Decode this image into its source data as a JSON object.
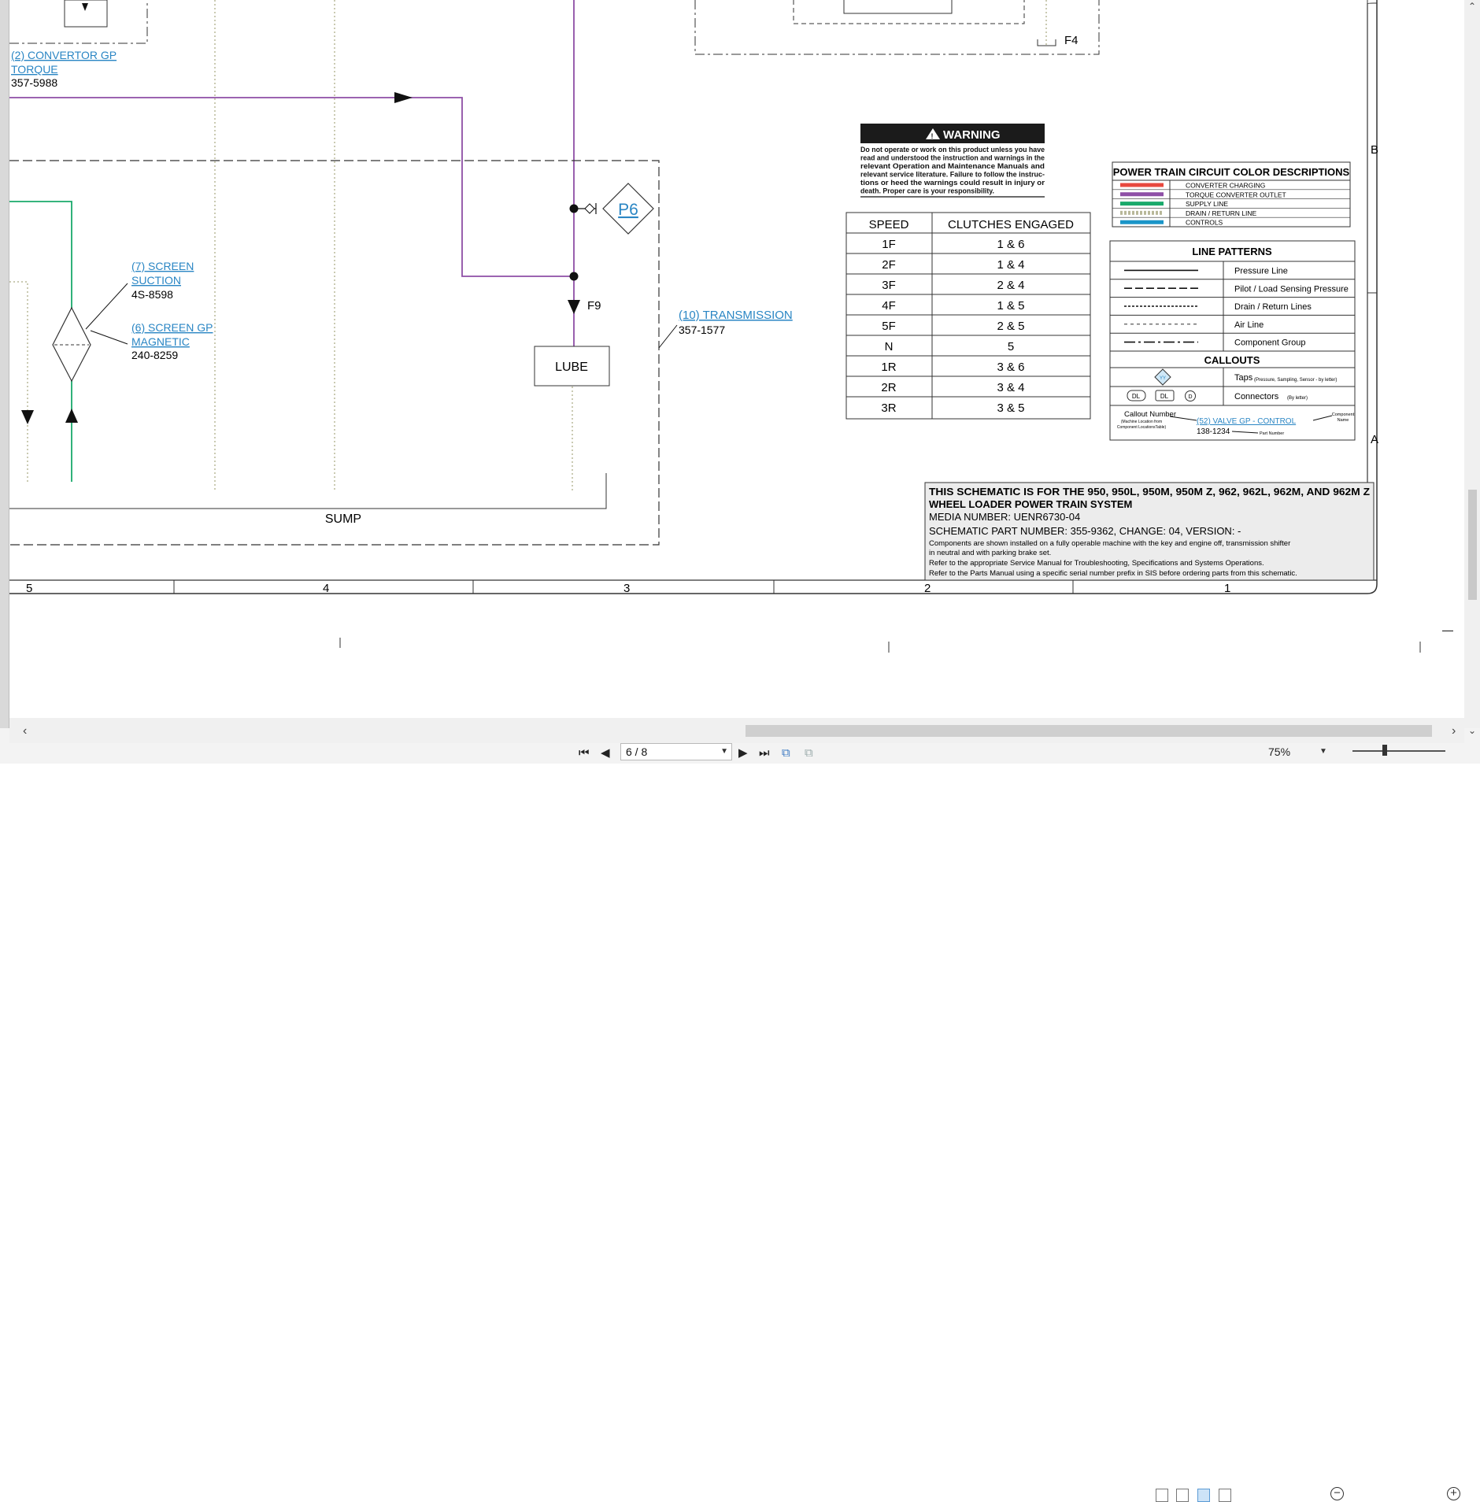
{
  "document": {
    "labels": {
      "convertor": {
        "link": [
          "(2) CONVERTOR GP",
          "TORQUE"
        ],
        "part": "357-5988"
      },
      "screen_suction": {
        "link": [
          "(7) SCREEN ",
          "SUCTION"
        ],
        "part": "4S-8598"
      },
      "screen_magnetic": {
        "link": [
          "(6) SCREEN GP",
          "MAGNETIC"
        ],
        "part": "240-8259"
      },
      "transmission": {
        "link": "(10) TRANSMISSION",
        "part": "357-1577"
      },
      "tap_p6": "P6",
      "f9": "F9",
      "f4": "F4",
      "lube": "LUBE",
      "sump": "SUMP"
    },
    "warning": {
      "title": "WARNING",
      "lines": [
        "Do not operate or work on this product unless you have",
        "read and understood the instruction and warnings in the",
        "relevant Operation and Maintenance Manuals and",
        "relevant service literature. Failure to follow the instruc-",
        "tions or heed the warnings could result in injury or",
        "death. Proper care is your responsibility."
      ]
    },
    "speed_table": {
      "headers": [
        "SPEED",
        "CLUTCHES ENGAGED"
      ],
      "rows": [
        [
          "1F",
          "1 & 6"
        ],
        [
          "2F",
          "1 & 4"
        ],
        [
          "3F",
          "2 & 4"
        ],
        [
          "4F",
          "1 & 5"
        ],
        [
          "5F",
          "2 & 5"
        ],
        [
          "N",
          "5"
        ],
        [
          "1R",
          "3 & 6"
        ],
        [
          "2R",
          "3 & 4"
        ],
        [
          "3R",
          "3 & 5"
        ]
      ]
    },
    "color_legend": {
      "title": "POWER TRAIN CIRCUIT COLOR DESCRIPTIONS",
      "items": [
        {
          "label": "CONVERTER CHARGING",
          "color": "#e8493f",
          "style": "solid"
        },
        {
          "label": "TORQUE CONVERTER OUTLET",
          "color": "#8e4fa6",
          "style": "solid"
        },
        {
          "label": "SUPPLY LINE",
          "color": "#1aa96b",
          "style": "solid"
        },
        {
          "label": "DRAIN / RETURN LINE",
          "color": "#b8b899",
          "style": "dotted"
        },
        {
          "label": "CONTROLS",
          "color": "#1b95c8",
          "style": "solid"
        }
      ]
    },
    "line_patterns": {
      "title": "LINE PATTERNS",
      "items": [
        "Pressure Line",
        "Pilot / Load Sensing Pressure",
        "Drain / Return Lines",
        "Air Line",
        "Component Group"
      ],
      "callouts_title": "CALLOUTS",
      "taps_label": "Taps",
      "taps_note": "(Pressure, Sampling, Sensor - by letter)",
      "tap_symbol": "YY",
      "connectors_label": "Connectors",
      "connectors_note": "(By letter)",
      "connector_symbols": [
        "DL",
        "DL",
        "D"
      ],
      "example": {
        "callout_number": "Callout Number",
        "callout_note": [
          "(Machine Location from",
          "Component LocationsTable)"
        ],
        "link": "(52) VALVE GP - CONTROL",
        "component_name": [
          "Component",
          "Name"
        ],
        "part": "138-1234",
        "part_label": "Part Number"
      }
    },
    "title_block": {
      "bold_lines": [
        "THIS SCHEMATIC IS FOR THE 950, 950L, 950M, 950M Z, 962, 962L, 962M, AND 962M Z",
        "WHEEL LOADER POWER TRAIN SYSTEM"
      ],
      "media": "MEDIA NUMBER: UENR6730-04",
      "part": "SCHEMATIC PART NUMBER: 355-9362, CHANGE: 04, VERSION: -",
      "notes": [
        "Components are shown installed on a fully operable machine with the key and engine off, transmission shifter",
        "in neutral and with parking brake set.",
        "Refer to the appropriate Service Manual for Troubleshooting, Specifications and Systems Operations.",
        "Refer to the Parts Manual using a specific serial number prefix in SIS before ordering parts from this schematic."
      ]
    },
    "zones": [
      "5",
      "4",
      "3",
      "2",
      "1"
    ],
    "rows": [
      "B",
      "A"
    ]
  },
  "toolbar": {
    "page_indicator": "6 / 8",
    "zoom": "75%"
  },
  "colors": {
    "link": "#2a86c4",
    "purple_line": "#8e4fa6",
    "green_line": "#1aa96b",
    "drain_line": "#b8b899"
  }
}
